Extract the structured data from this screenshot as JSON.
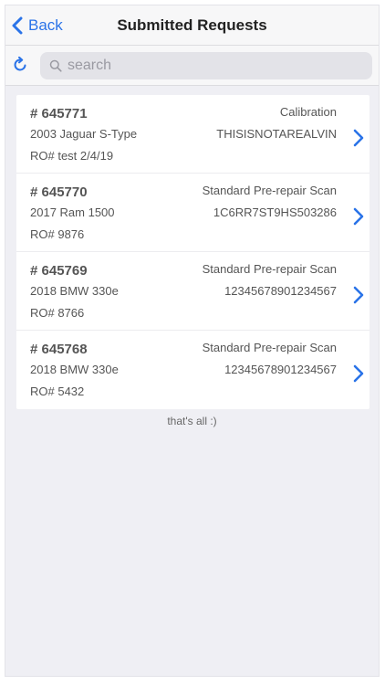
{
  "navbar": {
    "back_label": "Back",
    "title": "Submitted Requests"
  },
  "search": {
    "placeholder": "search",
    "value": ""
  },
  "requests": [
    {
      "number": "# 645771",
      "vehicle": "2003 Jaguar S-Type",
      "ro": "RO# test 2/4/19",
      "service": "Calibration",
      "vin": "THISISNOTAREALVIN"
    },
    {
      "number": "# 645770",
      "vehicle": "2017 Ram 1500",
      "ro": "RO# 9876",
      "service": "Standard Pre-repair Scan",
      "vin": "1C6RR7ST9HS503286"
    },
    {
      "number": "# 645769",
      "vehicle": "2018 BMW 330e",
      "ro": "RO# 8766",
      "service": "Standard Pre-repair Scan",
      "vin": "12345678901234567"
    },
    {
      "number": "# 645768",
      "vehicle": "2018 BMW 330e",
      "ro": "RO# 5432",
      "service": "Standard Pre-repair Scan",
      "vin": "12345678901234567"
    }
  ],
  "footer": {
    "text": "that's all :)"
  },
  "colors": {
    "accent": "#2a73e8",
    "background": "#efeff4",
    "card": "#ffffff"
  },
  "icons": {
    "back": "chevron-left-icon",
    "refresh": "refresh-icon",
    "search": "search-icon",
    "row_arrow": "chevron-right-icon"
  }
}
